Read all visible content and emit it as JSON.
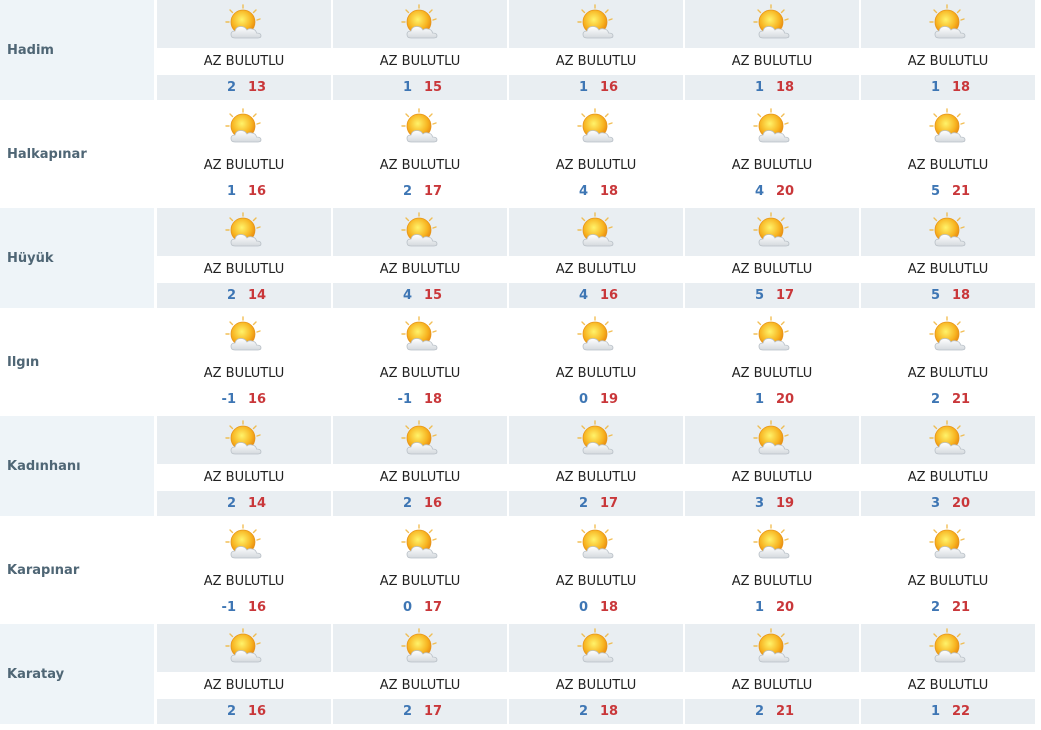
{
  "condition_label": "AZ BULUTLU",
  "icon": "partly-cloudy-sun-icon",
  "colors": {
    "min": "#3e76b4",
    "max": "#c9373a",
    "band": "#e9eef2",
    "city_bg": "#eef4f8",
    "city_text": "#4f6675"
  },
  "cities": [
    {
      "name": "Hadim",
      "days": [
        {
          "desc": "AZ BULUTLU",
          "min": "2",
          "max": "13"
        },
        {
          "desc": "AZ BULUTLU",
          "min": "1",
          "max": "15"
        },
        {
          "desc": "AZ BULUTLU",
          "min": "1",
          "max": "16"
        },
        {
          "desc": "AZ BULUTLU",
          "min": "1",
          "max": "18"
        },
        {
          "desc": "AZ BULUTLU",
          "min": "1",
          "max": "18"
        }
      ]
    },
    {
      "name": "Halkapınar",
      "days": [
        {
          "desc": "AZ BULUTLU",
          "min": "1",
          "max": "16"
        },
        {
          "desc": "AZ BULUTLU",
          "min": "2",
          "max": "17"
        },
        {
          "desc": "AZ BULUTLU",
          "min": "4",
          "max": "18"
        },
        {
          "desc": "AZ BULUTLU",
          "min": "4",
          "max": "20"
        },
        {
          "desc": "AZ BULUTLU",
          "min": "5",
          "max": "21"
        }
      ]
    },
    {
      "name": "Hüyük",
      "days": [
        {
          "desc": "AZ BULUTLU",
          "min": "2",
          "max": "14"
        },
        {
          "desc": "AZ BULUTLU",
          "min": "4",
          "max": "15"
        },
        {
          "desc": "AZ BULUTLU",
          "min": "4",
          "max": "16"
        },
        {
          "desc": "AZ BULUTLU",
          "min": "5",
          "max": "17"
        },
        {
          "desc": "AZ BULUTLU",
          "min": "5",
          "max": "18"
        }
      ]
    },
    {
      "name": "Ilgın",
      "days": [
        {
          "desc": "AZ BULUTLU",
          "min": "-1",
          "max": "16"
        },
        {
          "desc": "AZ BULUTLU",
          "min": "-1",
          "max": "18"
        },
        {
          "desc": "AZ BULUTLU",
          "min": "0",
          "max": "19"
        },
        {
          "desc": "AZ BULUTLU",
          "min": "1",
          "max": "20"
        },
        {
          "desc": "AZ BULUTLU",
          "min": "2",
          "max": "21"
        }
      ]
    },
    {
      "name": "Kadınhanı",
      "days": [
        {
          "desc": "AZ BULUTLU",
          "min": "2",
          "max": "14"
        },
        {
          "desc": "AZ BULUTLU",
          "min": "2",
          "max": "16"
        },
        {
          "desc": "AZ BULUTLU",
          "min": "2",
          "max": "17"
        },
        {
          "desc": "AZ BULUTLU",
          "min": "3",
          "max": "19"
        },
        {
          "desc": "AZ BULUTLU",
          "min": "3",
          "max": "20"
        }
      ]
    },
    {
      "name": "Karapınar",
      "days": [
        {
          "desc": "AZ BULUTLU",
          "min": "-1",
          "max": "16"
        },
        {
          "desc": "AZ BULUTLU",
          "min": "0",
          "max": "17"
        },
        {
          "desc": "AZ BULUTLU",
          "min": "0",
          "max": "18"
        },
        {
          "desc": "AZ BULUTLU",
          "min": "1",
          "max": "20"
        },
        {
          "desc": "AZ BULUTLU",
          "min": "2",
          "max": "21"
        }
      ]
    },
    {
      "name": "Karatay",
      "days": [
        {
          "desc": "AZ BULUTLU",
          "min": "2",
          "max": "16"
        },
        {
          "desc": "AZ BULUTLU",
          "min": "2",
          "max": "17"
        },
        {
          "desc": "AZ BULUTLU",
          "min": "2",
          "max": "18"
        },
        {
          "desc": "AZ BULUTLU",
          "min": "2",
          "max": "21"
        },
        {
          "desc": "AZ BULUTLU",
          "min": "1",
          "max": "22"
        }
      ]
    }
  ]
}
